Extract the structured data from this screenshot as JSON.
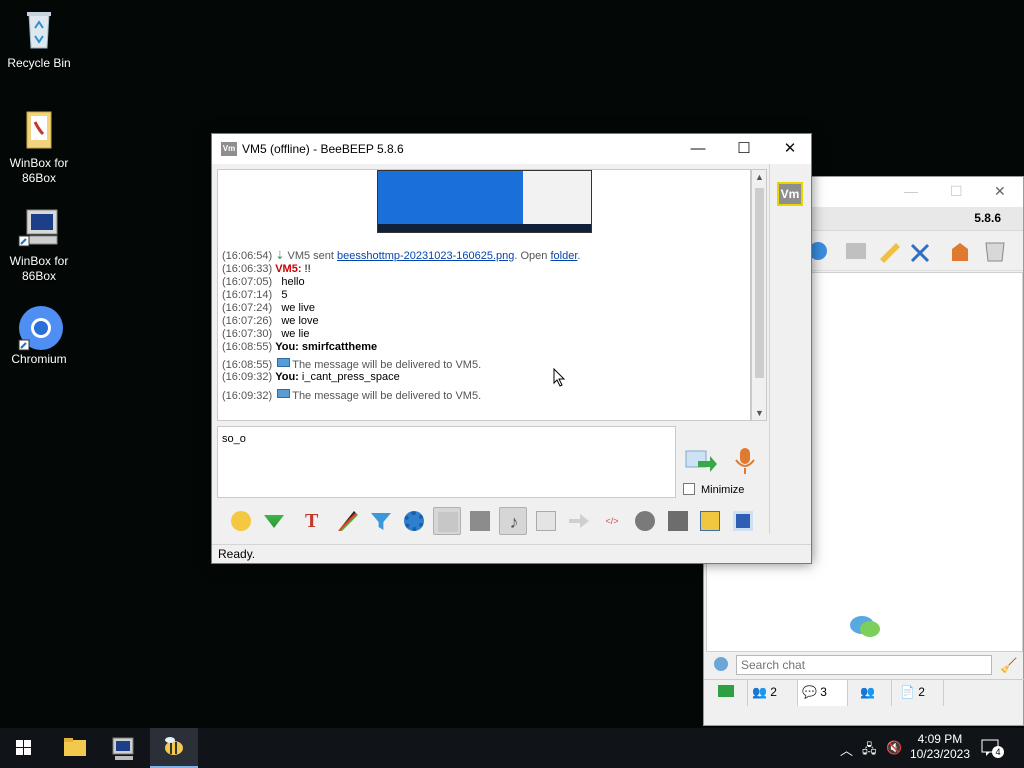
{
  "desktop": {
    "icons": [
      {
        "label": "Recycle Bin",
        "icon": "recycle-bin-icon"
      },
      {
        "label": "WinBox for\n86Box",
        "icon": "folder-icon"
      },
      {
        "label": "WinBox for\n86Box",
        "icon": "computer-shortcut-icon"
      },
      {
        "label": "Chromium",
        "icon": "chromium-icon"
      }
    ]
  },
  "main_window": {
    "title": "BeeBEEP 5.8.6",
    "version": "5.8.6",
    "search_placeholder": "Search chat",
    "tabs": [
      {
        "icon": "monitor-icon",
        "count": ""
      },
      {
        "icon": "users-icon",
        "count": "2"
      },
      {
        "icon": "chat-icon",
        "count": "3"
      },
      {
        "icon": "groups-icon",
        "count": ""
      },
      {
        "icon": "files-icon",
        "count": "2"
      }
    ]
  },
  "chat_window": {
    "title": "VM5 (offline) - BeeBEEP 5.8.6",
    "avatar_label": "Vm",
    "messages": [
      {
        "ts": "(16:06:54)",
        "kind": "file",
        "pre": " VM5 sent ",
        "link": "beesshottmp-20231023-160625.png",
        "mid": ". Open ",
        "link2": "folder",
        "post": "."
      },
      {
        "ts": "(16:06:33)",
        "kind": "sender",
        "sender": "VM5:",
        "text": " !!"
      },
      {
        "ts": "(16:07:05)",
        "kind": "cont",
        "text": "hello"
      },
      {
        "ts": "(16:07:14)",
        "kind": "cont",
        "text": "5"
      },
      {
        "ts": "(16:07:24)",
        "kind": "cont",
        "text": "we live"
      },
      {
        "ts": "(16:07:26)",
        "kind": "cont",
        "text": "we love"
      },
      {
        "ts": "(16:07:30)",
        "kind": "cont",
        "text": "we lie"
      },
      {
        "ts": "(16:08:55)",
        "kind": "you",
        "sender": "You:",
        "text": " smirfcattheme",
        "bold": true
      },
      {
        "ts": "(16:08:55)",
        "kind": "system",
        "text": "The message will be delivered to VM5."
      },
      {
        "ts": "(16:09:32)",
        "kind": "you",
        "sender": "You:",
        "text": " i_cant_press_space",
        "bold": false
      },
      {
        "ts": "(16:09:32)",
        "kind": "system",
        "text": "The message will be delivered to VM5."
      }
    ],
    "compose_text": "so_o",
    "minimize_label": "Minimize",
    "status": "Ready."
  },
  "taskbar": {
    "time": "4:09 PM",
    "date": "10/23/2023",
    "notification_count": "4"
  }
}
